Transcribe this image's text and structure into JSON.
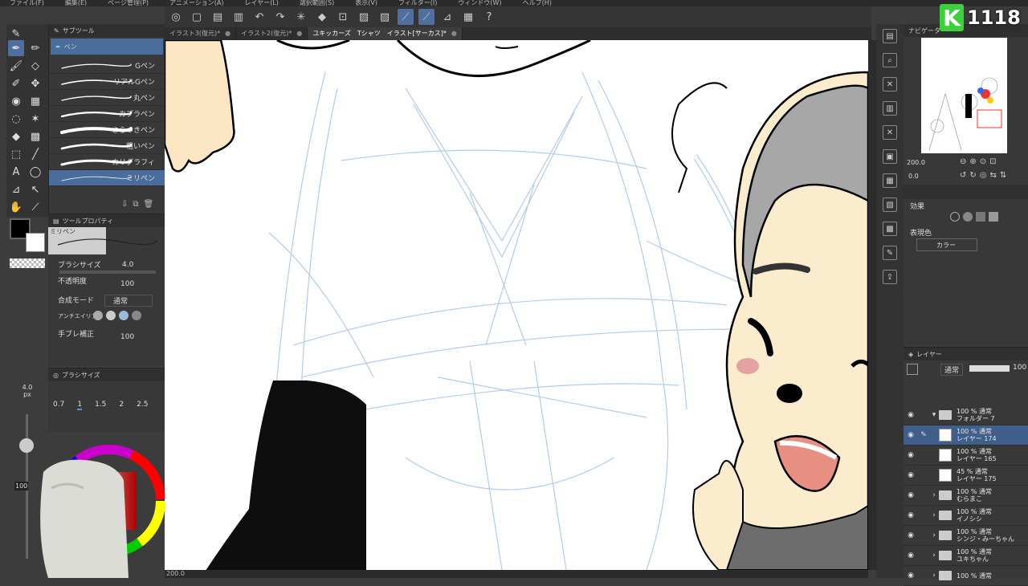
{
  "menu": [
    "ファイル(F)",
    "編集(E)",
    "ページ管理(P)",
    "アニメーション(A)",
    "レイヤー(L)",
    "選択範囲(S)",
    "表示(V)",
    "フィルター(I)",
    "ウィンドウ(W)",
    "ヘルプ(H)"
  ],
  "tabs": [
    {
      "label": "イラスト3(復元)*",
      "active": false
    },
    {
      "label": "イラスト2(復元)*",
      "active": false
    },
    {
      "label": "ユキッカーズ　Tシャツ　イラスト[サーカス]*",
      "active": true
    }
  ],
  "subtool": {
    "header": "サブツール",
    "group": "ペン",
    "brushes": [
      "Gペン",
      "リアルGペン",
      "丸ペン",
      "カブラペン",
      "さらつきペン",
      "粗いペン",
      "カリグラフィ",
      "ミリペン"
    ],
    "active_index": 7
  },
  "tool_property": {
    "header": "ツールプロパティ",
    "preset_name": "ミリペン",
    "brush_size_label": "ブラシサイズ",
    "brush_size_value": "4.0",
    "opacity_label": "不透明度",
    "opacity_value": "100",
    "blend_label": "合成モード",
    "blend_value": "通常",
    "antialias_label": "アンチエイリアス",
    "stabilize_label": "手ブレ補正",
    "stabilize_value": "100"
  },
  "brush_size_panel": {
    "header": "ブラシサイズ",
    "sizes": [
      "0.7",
      "1",
      "1.5",
      "2",
      "2.5"
    ],
    "current": "4.0",
    "unit": "px",
    "opacity_pct": "100"
  },
  "navigator": {
    "header": "ナビゲーター",
    "zoom": "200.0",
    "angle": "0.0"
  },
  "layer_property": {
    "effect_label": "効果",
    "express_label": "表現色",
    "express_value": "カラー"
  },
  "layers": {
    "header": "レイヤー",
    "blend": "通常",
    "opacity": "100",
    "rows": [
      {
        "line1": "100 % 通常",
        "line2": "フォルダー 7",
        "kind": "folder-open",
        "active": false
      },
      {
        "line1": "100 % 通常",
        "line2": "レイヤー 174",
        "kind": "layer",
        "active": true
      },
      {
        "line1": "100 % 通常",
        "line2": "レイヤー 165",
        "kind": "layer",
        "active": false
      },
      {
        "line1": "45 % 通常",
        "line2": "レイヤー 175",
        "kind": "layer",
        "active": false
      },
      {
        "line1": "100 % 通常",
        "line2": "むらまこ",
        "kind": "folder",
        "active": false
      },
      {
        "line1": "100 % 通常",
        "line2": "イノシシ",
        "kind": "folder",
        "active": false
      },
      {
        "line1": "100 % 通常",
        "line2": "シンジ・みーちゃん",
        "kind": "folder",
        "active": false
      },
      {
        "line1": "100 % 通常",
        "line2": "ユキちゃん",
        "kind": "folder",
        "active": false
      },
      {
        "line1": "100 % 通常",
        "line2": "",
        "kind": "folder",
        "active": false
      }
    ]
  },
  "status": {
    "zoom": "200.0"
  },
  "badge": {
    "letter": "K",
    "number": "1118"
  },
  "colors": {
    "accent": "#4f6f9f",
    "badge": "#3bd13b",
    "sketch": "#a9c7ea"
  }
}
